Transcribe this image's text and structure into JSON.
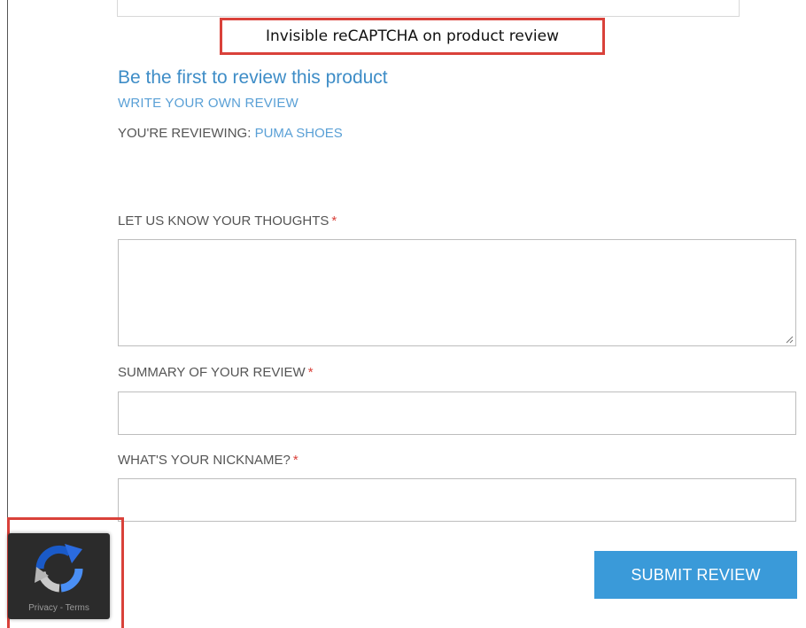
{
  "callout": {
    "text": "Invisible reCAPTCHA on product review"
  },
  "review": {
    "first_review": "Be the first to review this product",
    "write_review": "WRITE YOUR OWN REVIEW",
    "reviewing_label": "YOU'RE REVIEWING:",
    "product_name": "PUMA SHOES"
  },
  "form": {
    "thoughts_label": "LET US KNOW YOUR THOUGHTS",
    "summary_label": "SUMMARY OF YOUR REVIEW",
    "nickname_label": "WHAT'S YOUR NICKNAME?",
    "required_mark": "*",
    "thoughts_value": "",
    "summary_value": "",
    "nickname_value": "",
    "submit_label": "SUBMIT REVIEW"
  },
  "recaptcha": {
    "icon": "recaptcha-logo-icon",
    "privacy": "Privacy",
    "separator": " - ",
    "terms": "Terms"
  },
  "colors": {
    "accent_blue": "#3a9ad9",
    "link_blue": "#5aa0d6",
    "required_red": "#d9413a",
    "annotation_red": "#d9413a"
  }
}
